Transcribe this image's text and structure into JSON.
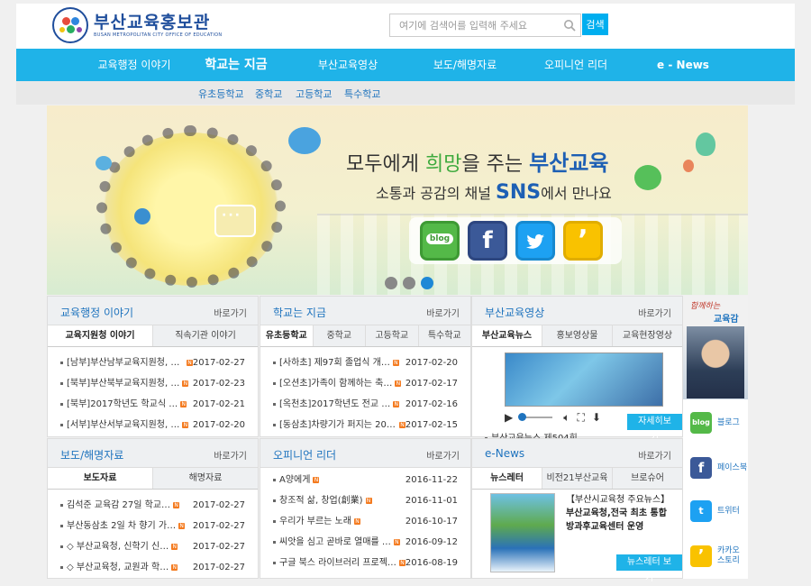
{
  "header": {
    "logo_title": "부산교육홍보관",
    "logo_sub": "BUSAN METROPOLITAN CITY OFFICE OF EDUCATION",
    "search_placeholder": "여기에 검색어를 입력해 주세요",
    "search_button": "검색"
  },
  "nav": {
    "items": [
      "교육행정 이야기",
      "학교는 지금",
      "부산교육영상",
      "보도/해명자료",
      "오피니언 리더",
      "e - News"
    ]
  },
  "subnav": {
    "items": [
      "유초등학교",
      "중학교",
      "고등학교",
      "특수학교"
    ]
  },
  "banner": {
    "line1_a": "모두에게 ",
    "line1_b": "희망",
    "line1_c": "을 주는 ",
    "line1_d": "부산교육",
    "line2_a": "소통과 공감",
    "line2_b": "의 채널 ",
    "line2_c": "SNS",
    "line2_d": "에서 만나요",
    "blog": "blog",
    "facebook": "f",
    "kakao": "’"
  },
  "panel_admin": {
    "title": "교육행정 이야기",
    "more": "바로가기",
    "tabs": [
      "교육지원청 이야기",
      "직속기관 이야기"
    ],
    "items": [
      {
        "title": "[남부]부산남부교육지원청, 「…",
        "date": "2017-02-27"
      },
      {
        "title": "[북부]부산북부교육지원청, …",
        "date": "2017-02-23"
      },
      {
        "title": "[북부]2017학년도 학교식 …",
        "date": "2017-02-21"
      },
      {
        "title": "[서부]부산서부교육지원청, …",
        "date": "2017-02-20"
      }
    ]
  },
  "panel_school": {
    "title": "학교는 지금",
    "more": "바로가기",
    "tabs": [
      "유초등학교",
      "중학교",
      "고등학교",
      "특수학교"
    ],
    "items": [
      {
        "title": "[사하초] 제97회 졸업식 개…",
        "date": "2017-02-20"
      },
      {
        "title": "[오션초]가족이 함께하는 축…",
        "date": "2017-02-17"
      },
      {
        "title": "[옥천초]2017학년도 전교 …",
        "date": "2017-02-16"
      },
      {
        "title": "[동삼초]차량기가 퍼지는 201…",
        "date": "2017-02-15"
      }
    ]
  },
  "panel_video": {
    "title": "부산교육영상",
    "more": "바로가기",
    "tabs": [
      "부산교육뉴스",
      "홍보영상물",
      "교육현장영상"
    ],
    "item": "부산교육뉴스 제504회 …",
    "button": "자세히보기"
  },
  "panel_press": {
    "title": "보도/해명자료",
    "more": "바로가기",
    "tabs": [
      "보도자료",
      "해명자료"
    ],
    "items": [
      {
        "title": "김석준 교육감 27일 학교…",
        "date": "2017-02-27"
      },
      {
        "title": "부산동삼초 2일 차 향기 가…",
        "date": "2017-02-27"
      },
      {
        "title": "◇ 부산교육청, 신학기 신…",
        "date": "2017-02-27"
      },
      {
        "title": "◇ 부산교육청, 교원과 학…",
        "date": "2017-02-27"
      }
    ]
  },
  "panel_opinion": {
    "title": "오피니언 리더",
    "more": "바로가기",
    "items": [
      {
        "title": "A양에게",
        "date": "2016-11-22"
      },
      {
        "title": "창조적 삶, 창업(創業)",
        "date": "2016-11-01"
      },
      {
        "title": "우리가 부르는 노래",
        "date": "2016-10-17"
      },
      {
        "title": "씨앗을 심고 곧바로 열매를 …",
        "date": "2016-09-12"
      },
      {
        "title": "구글 북스 라이브러리 프로젝…",
        "date": "2016-08-19"
      }
    ]
  },
  "panel_enews": {
    "title": "e-News",
    "more": "바로가기",
    "tabs": [
      "뉴스레터",
      "비전21부산교육",
      "브로슈어"
    ],
    "headline": "【부산시교육청 주요뉴스】",
    "text": "부산교육청,전국 최초 통합방과후교육센터 운영",
    "button": "뉴스레터 보기"
  },
  "sidebar": {
    "title1": "함께하는",
    "title2": "교육감",
    "links": [
      {
        "label": "블로그",
        "icon": "blog"
      },
      {
        "label": "페이스북",
        "icon": "f"
      },
      {
        "label": "트위터",
        "icon": "t"
      },
      {
        "label": "카카오\n스토리",
        "icon": "’"
      }
    ]
  }
}
